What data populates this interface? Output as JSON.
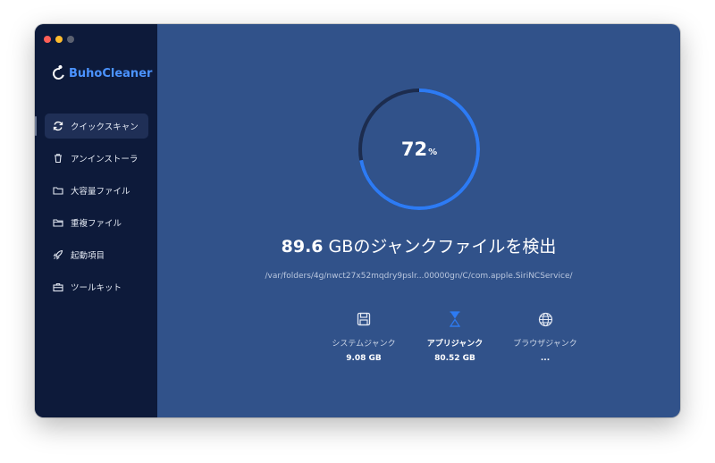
{
  "app": {
    "name": "BuhoCleaner"
  },
  "sidebar": {
    "items": [
      {
        "label": "クイックスキャン",
        "icon": "refresh-icon",
        "active": true
      },
      {
        "label": "アンインストーラ",
        "icon": "trash-icon",
        "active": false
      },
      {
        "label": "大容量ファイル",
        "icon": "folder-icon",
        "active": false
      },
      {
        "label": "重複ファイル",
        "icon": "folder-duplicate-icon",
        "active": false
      },
      {
        "label": "起動項目",
        "icon": "rocket-icon",
        "active": false
      },
      {
        "label": "ツールキット",
        "icon": "toolbox-icon",
        "active": false
      }
    ]
  },
  "scan": {
    "progress": 72,
    "progress_value": "72",
    "progress_unit": "%",
    "found_size": "89.6",
    "found_text": " GBのジャンクファイルを検出",
    "current_path": "/var/folders/4g/nwct27x52mqdry9pslr...00000gn/C/com.apple.SiriNCService/"
  },
  "stats": [
    {
      "label": "システムジャンク",
      "value": "9.08 GB",
      "icon": "floppy-disk-icon",
      "active": false
    },
    {
      "label": "アプリジャンク",
      "value": "80.52 GB",
      "icon": "hourglass-icon",
      "active": true
    },
    {
      "label": "ブラウザジャンク",
      "value": "...",
      "icon": "globe-icon",
      "active": false
    }
  ],
  "colors": {
    "accent": "#2d7bf4",
    "ring_track": "#1c2c4e",
    "sidebar_bg": "#0d1a3a",
    "main_bg": "#31528a"
  }
}
